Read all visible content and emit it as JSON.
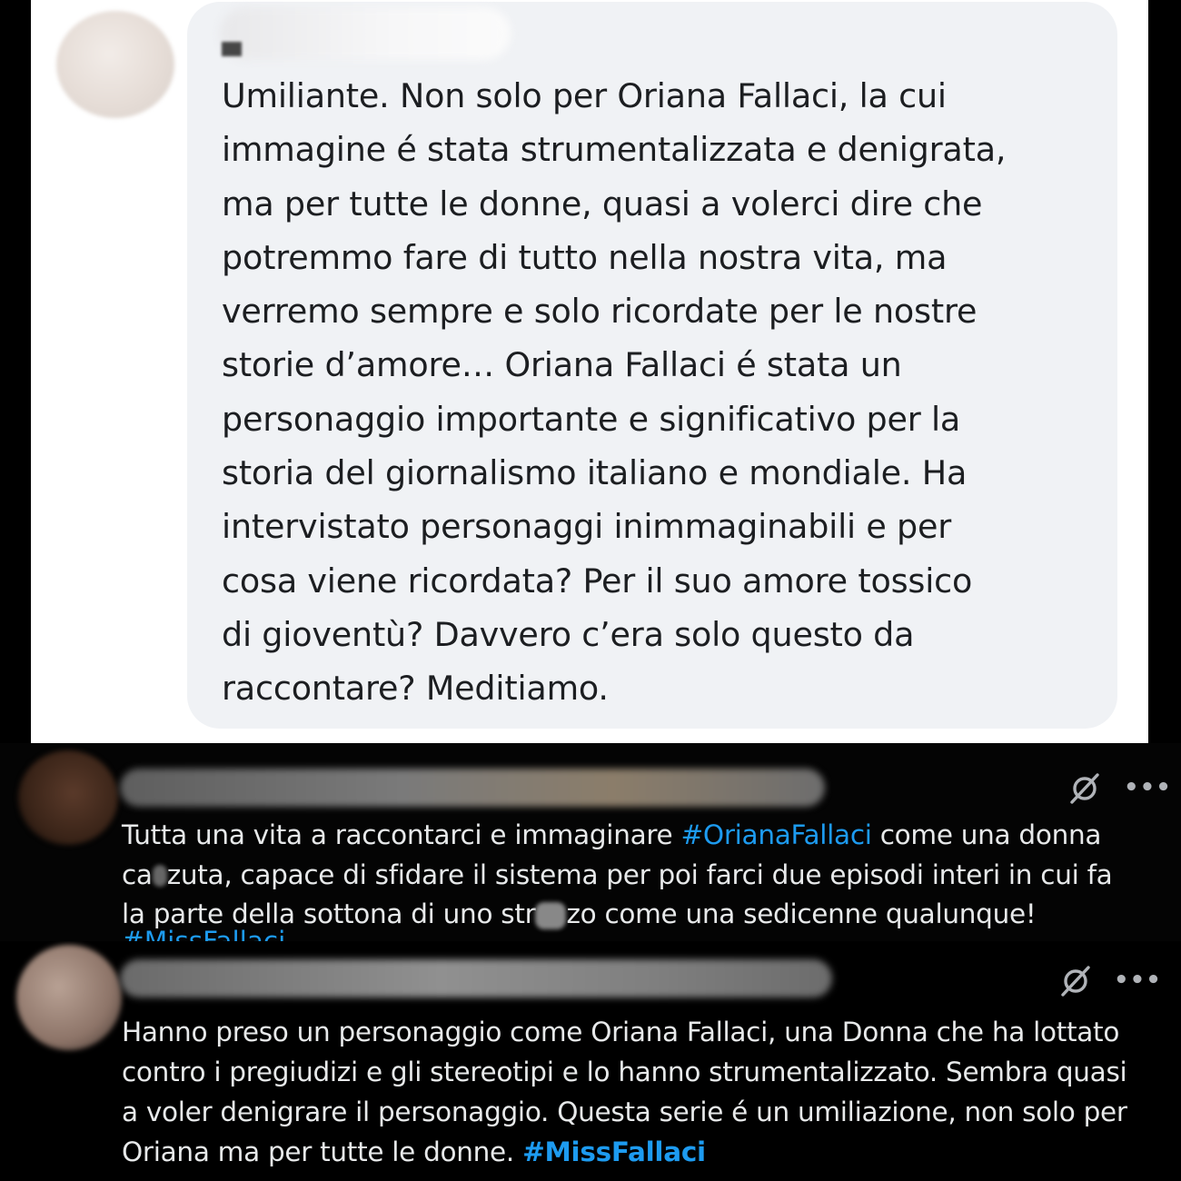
{
  "facebook_comment": {
    "lines": [
      "Umiliante. Non solo per Oriana Fallaci, la cui",
      "immagine é stata strumentalizzata e denigrata,",
      "ma per tutte le donne, quasi a volerci dire che",
      "potremmo fare di tutto nella nostra vita, ma",
      "verremo sempre e solo ricordate per le nostre",
      "storie d’amore… Oriana Fallaci é stata un",
      "personaggio importante e significativo per la",
      "storia del giornalismo italiano e mondiale. Ha",
      "intervistato personaggi inimmaginabili e per",
      "cosa viene ricordata? Per il suo amore tossico",
      "di gioventù? Davvero c’era solo questo da",
      "raccontare? Meditiamo."
    ]
  },
  "tweet_1": {
    "line1_before": "Tutta una vita a raccontarci e immaginare ",
    "line1_hashtag": "#OrianaFallaci",
    "line1_after": " come una donna",
    "line2_before": "ca",
    "line2_after": "zuta, capace di sfidare il sistema per poi farci due episodi interi in cui fa",
    "line3_before": "la parte della sottona di uno str",
    "line3_after": "zo come una sedicenne qualunque!",
    "line4_cut": "#MissFallaci",
    "more_label": "•••"
  },
  "tweet_2": {
    "lines": [
      "Hanno preso un personaggio come Oriana Fallaci, una Donna che ha lottato",
      "contro i pregiudizi e gli stereotipi e lo hanno strumentalizzato. Sembra quasi",
      "a voler denigrare il personaggio. Questa serie é un umiliazione, non solo per"
    ],
    "line4_before": "Oriana ma per tutte le donne. ",
    "line4_hashtag": "#MissFallaci",
    "more_label": "•••"
  },
  "icons": {
    "grok": "grok-icon",
    "more": "more-icon"
  },
  "colors": {
    "hashtag": "#1d9bf0",
    "dark_text": "#e7e9ea",
    "light_text": "#1c1e21",
    "bubble": "#f0f2f5"
  }
}
